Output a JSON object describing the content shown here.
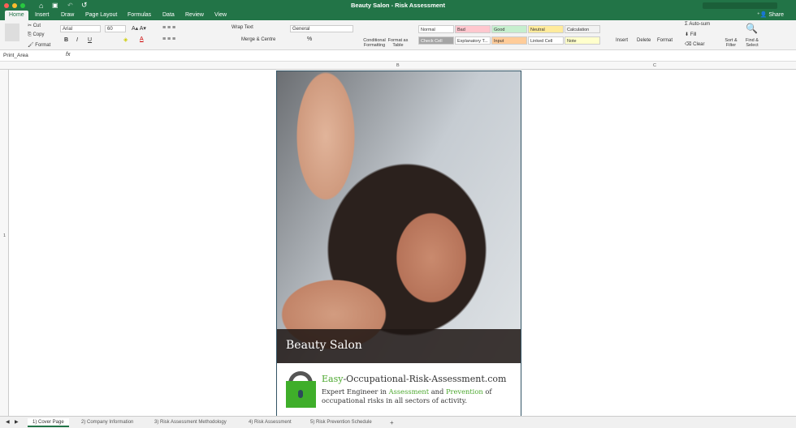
{
  "window": {
    "title": "Beauty Salon - Risk Assessment",
    "share": "Share"
  },
  "tabs": [
    "Home",
    "Insert",
    "Draw",
    "Page Layout",
    "Formulas",
    "Data",
    "Review",
    "View"
  ],
  "ribbon": {
    "cut": "Cut",
    "copy": "Copy",
    "format": "Format",
    "font": "Arial",
    "size": "60",
    "wrap": "Wrap Text",
    "merge": "Merge & Centre",
    "number_format": "General",
    "percent": "%",
    "conditional": "Conditional Formatting",
    "format_table": "Format as Table",
    "styles": [
      {
        "label": "Normal",
        "bg": "#ffffff"
      },
      {
        "label": "Bad",
        "bg": "#ffc7ce"
      },
      {
        "label": "Good",
        "bg": "#c6efce"
      },
      {
        "label": "Neutral",
        "bg": "#ffeb9c"
      },
      {
        "label": "Calculation",
        "bg": "#f2f2f2"
      },
      {
        "label": "Check Cell",
        "bg": "#a5a5a5"
      },
      {
        "label": "Explanatory T...",
        "bg": "#ffffff"
      },
      {
        "label": "Input",
        "bg": "#ffcc99"
      },
      {
        "label": "Linked Cell",
        "bg": "#ffffff"
      },
      {
        "label": "Note",
        "bg": "#ffffcc"
      }
    ],
    "insert": "Insert",
    "delete": "Delete",
    "format_cells": "Format",
    "autosum": "Auto-sum",
    "fill": "Fill",
    "clear": "Clear",
    "sort": "Sort & Filter",
    "find": "Find & Select"
  },
  "formula": {
    "name_box": "Print_Area",
    "fx": "fx",
    "value": ""
  },
  "columns": [
    "B",
    "C"
  ],
  "rows": [
    "1"
  ],
  "cover": {
    "caption": "Beauty Salon",
    "site_prefix": "Easy",
    "site_rest": "-Occupational-Risk-Assessment.com",
    "tag1": "Expert Engineer in ",
    "tag_assess": "Assessment",
    "tag2": " and ",
    "tag_prev": "Prevention",
    "tag3": " of occupational risks in all sectors of activity."
  },
  "sheets": [
    "1) Cover Page",
    "2) Company Information",
    "3) Risk Assessment Methodology",
    "4) Risk Assessment",
    "5) Risk Prevention Schedule"
  ],
  "add_sheet": "+"
}
